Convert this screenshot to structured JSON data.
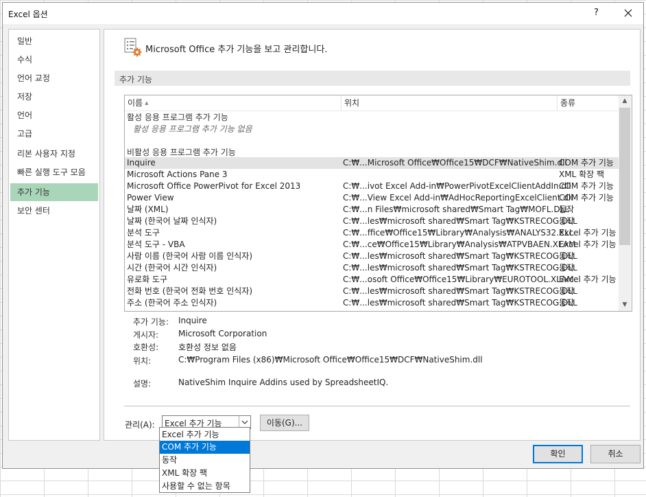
{
  "window": {
    "title": "Excel 옵션",
    "help": "?"
  },
  "nav": {
    "items": [
      {
        "label": "일반"
      },
      {
        "label": "수식"
      },
      {
        "label": "언어 교정"
      },
      {
        "label": "저장"
      },
      {
        "label": "언어"
      },
      {
        "label": "고급"
      },
      {
        "label": "리본 사용자 지정"
      },
      {
        "label": "빠른 실행 도구 모음"
      },
      {
        "label": "추가 기능",
        "active": true
      },
      {
        "label": "보안 센터"
      }
    ]
  },
  "header": {
    "text": "Microsoft Office 추가 기능을 보고 관리합니다."
  },
  "section": {
    "title": "추가 기능"
  },
  "list": {
    "columns": {
      "name": "이름",
      "location": "위치",
      "type": "종류"
    },
    "active_group": {
      "title": "활성 응용 프로그램 추가 기능",
      "empty": "활성 응용 프로그램 추가 기능 없음"
    },
    "inactive_group": {
      "title": "비활성 응용 프로그램 추가 기능"
    },
    "rows": [
      {
        "name": "Inquire",
        "location": "C:₩...Microsoft Office₩Office15₩DCF₩NativeShim.dll",
        "type": "COM 추가 기능"
      },
      {
        "name": "Microsoft Actions Pane 3",
        "location": "",
        "type": "XML 확장 팩"
      },
      {
        "name": "Microsoft Office PowerPivot for Excel 2013",
        "location": "C:₩...ivot Excel Add-in₩PowerPivotExcelClientAddIn.dll",
        "type": "COM 추가 기능"
      },
      {
        "name": "Power View",
        "location": "C:₩...View Excel Add-in₩AdHocReportingExcelClient.dll",
        "type": "COM 추가 기능"
      },
      {
        "name": "날짜 (XML)",
        "location": "C:₩...n Files₩microsoft shared₩Smart Tag₩MOFL.DLL",
        "type": "동작"
      },
      {
        "name": "날짜 (한국어 날짜 인식자)",
        "location": "C:₩...les₩microsoft shared₩Smart Tag₩KSTRECOG.DLL",
        "type": "동작"
      },
      {
        "name": "분석 도구",
        "location": "C:₩...ffice₩Office15₩Library₩Analysis₩ANALYS32.XLL",
        "type": "Excel 추가 기능"
      },
      {
        "name": "분석 도구 - VBA",
        "location": "C:₩...ce₩Office15₩Library₩Analysis₩ATPVBAEN.XLAM",
        "type": "Excel 추가 기능"
      },
      {
        "name": "사람 이름 (한국어 사람 이름 인식자)",
        "location": "C:₩...les₩microsoft shared₩Smart Tag₩KSTRECOG.DLL",
        "type": "동작"
      },
      {
        "name": "시간 (한국어 시간 인식자)",
        "location": "C:₩...les₩microsoft shared₩Smart Tag₩KSTRECOG.DLL",
        "type": "동작"
      },
      {
        "name": "유로화 도구",
        "location": "C:₩...osoft Office₩Office15₩Library₩EUROTOOL.XLAM",
        "type": "Excel 추가 기능"
      },
      {
        "name": "전화 번호 (한국어 전화 번호 인식자)",
        "location": "C:₩...les₩microsoft shared₩Smart Tag₩KSTRECOG.DLL",
        "type": "동작"
      },
      {
        "name": "주소 (한국어 주소 인식자)",
        "location": "C:₩...les₩microsoft shared₩Smart Tag₩KSTRECOG.DLL",
        "type": "동작"
      }
    ]
  },
  "details": {
    "addin_label": "추가 기능:",
    "addin_value": "Inquire",
    "publisher_label": "게시자:",
    "publisher_value": "Microsoft Corporation",
    "compat_label": "호환성:",
    "compat_value": "호환성 정보 없음",
    "location_label": "위치:",
    "location_value": "C:₩Program Files (x86)₩Microsoft Office₩Office15₩DCF₩NativeShim.dll",
    "desc_label": "설명:",
    "desc_value": "NativeShim Inquire Addins used by SpreadsheetIQ."
  },
  "manage": {
    "label": "관리(A):",
    "selected": "Excel 추가 기능",
    "go_label": "이동(G)...",
    "options": [
      "Excel 추가 기능",
      "COM 추가 기능",
      "동작",
      "XML 확장 팩",
      "사용할 수 없는 항목"
    ],
    "highlighted_index": 1
  },
  "footer": {
    "ok_label": "확인",
    "cancel_label": "취소"
  },
  "colors": {
    "accent": "#0078d7",
    "nav_active": "#a9d5b9"
  }
}
